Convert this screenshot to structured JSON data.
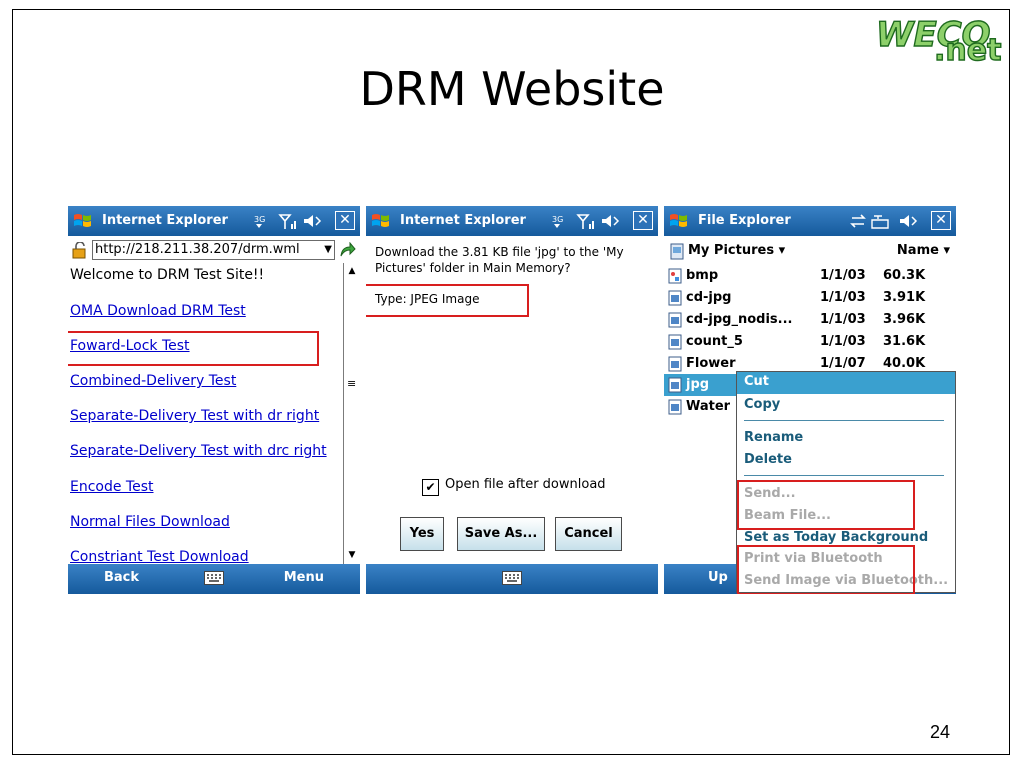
{
  "slide": {
    "title": "DRM Website",
    "page_number": "24"
  },
  "logo": {
    "text_top": "WECO",
    "text_bottom": ".net"
  },
  "colors": {
    "titlebar": "#1f6cb0",
    "selection": "#3aa0cf",
    "highlight_box": "#d81e1e",
    "link": "#0000cc"
  },
  "phone1": {
    "title": "Internet Explorer",
    "address": "http://218.211.38.207/drm.wml",
    "welcome": "Welcome to DRM Test Site!!",
    "links": [
      "OMA Download DRM Test",
      "Foward-Lock Test",
      "Combined-Delivery Test",
      "Separate-Delivery Test with dr right",
      "Separate-Delivery Test with drc right",
      "Encode Test",
      "Normal Files Download",
      "Constriant Test Download"
    ],
    "soft_left": "Back",
    "soft_right": "Menu"
  },
  "phone2": {
    "title": "Internet Explorer",
    "message": "Download the 3.81 KB file 'jpg' to the 'My Pictures' folder in Main Memory?",
    "type": "Type: JPEG Image",
    "checkbox_label": "Open file after download",
    "checkbox_checked": true,
    "buttons": {
      "yes": "Yes",
      "save_as": "Save As...",
      "cancel": "Cancel"
    }
  },
  "phone3": {
    "title": "File Explorer",
    "folder": "My Pictures",
    "sort": "Name",
    "files": [
      {
        "name": "bmp",
        "date": "1/1/03",
        "size": "60.3K"
      },
      {
        "name": "cd-jpg",
        "date": "1/1/03",
        "size": "3.91K"
      },
      {
        "name": "cd-jpg_nodis...",
        "date": "1/1/03",
        "size": "3.96K"
      },
      {
        "name": "count_5",
        "date": "1/1/03",
        "size": "31.6K"
      },
      {
        "name": "Flower",
        "date": "1/1/07",
        "size": "40.0K"
      },
      {
        "name": "jpg",
        "date": "",
        "size": ""
      },
      {
        "name": "Water",
        "date": "",
        "size": ""
      }
    ],
    "soft_left": "Up",
    "menu": {
      "cut": "Cut",
      "copy": "Copy",
      "rename": "Rename",
      "delete": "Delete",
      "send": "Send...",
      "beam": "Beam File...",
      "set_background": "Set as Today Background",
      "print_bt": "Print via Bluetooth",
      "send_bt": "Send Image via Bluetooth..."
    }
  }
}
